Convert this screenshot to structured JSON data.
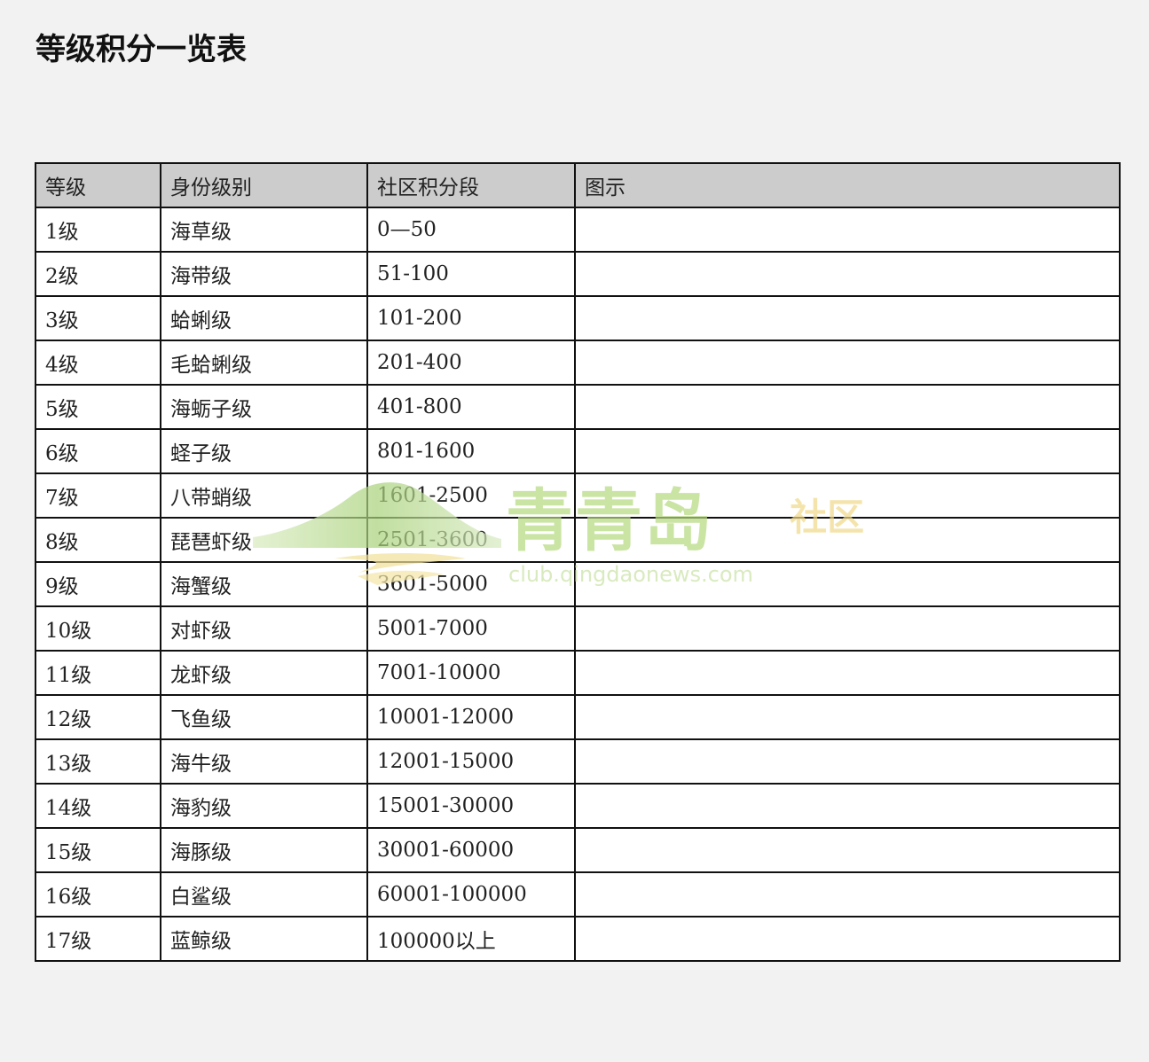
{
  "page": {
    "title": "等级积分一览表"
  },
  "table": {
    "headers": [
      "等级",
      "身份级别",
      "社区积分段",
      "图示"
    ],
    "rows": [
      {
        "level": "1级",
        "rank": "海草级",
        "points": "0—50",
        "icon": ""
      },
      {
        "level": "2级",
        "rank": "海带级",
        "points": "51-100",
        "icon": ""
      },
      {
        "level": "3级",
        "rank": "蛤蜊级",
        "points": "101-200",
        "icon": ""
      },
      {
        "level": "4级",
        "rank": "毛蛤蜊级",
        "points": "201-400",
        "icon": ""
      },
      {
        "level": "5级",
        "rank": "海蛎子级",
        "points": "401-800",
        "icon": ""
      },
      {
        "level": "6级",
        "rank": "蛏子级",
        "points": "801-1600",
        "icon": ""
      },
      {
        "level": "7级",
        "rank": "八带蛸级",
        "points": "1601-2500",
        "icon": ""
      },
      {
        "level": "8级",
        "rank": "琵琶虾级",
        "points": "2501-3600",
        "icon": ""
      },
      {
        "level": "9级",
        "rank": "海蟹级",
        "points": "3601-5000",
        "icon": ""
      },
      {
        "level": "10级",
        "rank": "对虾级",
        "points": "5001-7000",
        "icon": ""
      },
      {
        "level": "11级",
        "rank": "龙虾级",
        "points": "7001-10000",
        "icon": ""
      },
      {
        "level": "12级",
        "rank": "飞鱼级",
        "points": "10001-12000",
        "icon": ""
      },
      {
        "level": "13级",
        "rank": "海牛级",
        "points": "12001-15000",
        "icon": ""
      },
      {
        "level": "14级",
        "rank": "海豹级",
        "points": "15001-30000",
        "icon": ""
      },
      {
        "level": "15级",
        "rank": "海豚级",
        "points": "30001-60000",
        "icon": ""
      },
      {
        "level": "16级",
        "rank": "白鲨级",
        "points": "60001-100000",
        "icon": ""
      },
      {
        "level": "17级",
        "rank": "蓝鲸级",
        "points": "100000以上",
        "icon": ""
      }
    ]
  },
  "watermark": {
    "brand": "青青岛",
    "suffix": "社区",
    "url": "club.qingdaonews.com"
  }
}
